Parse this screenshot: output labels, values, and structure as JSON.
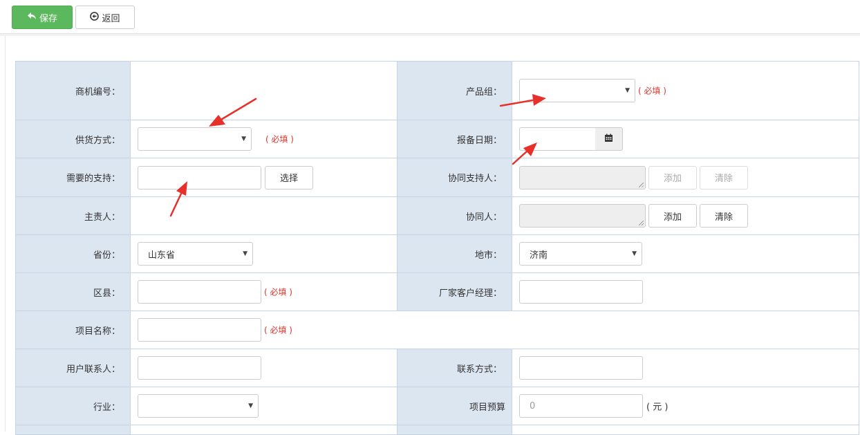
{
  "toolbar": {
    "save_label": "保存",
    "back_label": "返回"
  },
  "form": {
    "opportunity_no": {
      "label": "商机编号：",
      "value": ""
    },
    "product_group": {
      "label": "产品组：",
      "value": "",
      "required": "( 必填 )"
    },
    "supply_mode": {
      "label": "供货方式：",
      "value": "",
      "required": "( 必填 )"
    },
    "report_date": {
      "label": "报备日期：",
      "value": ""
    },
    "support_needed": {
      "label": "需要的支持：",
      "value": "",
      "button": "选择"
    },
    "co_supporter": {
      "label": "协同支持人：",
      "add": "添加",
      "clear": "清除"
    },
    "owner": {
      "label": "主责人：",
      "value": ""
    },
    "collaborator": {
      "label": "协同人：",
      "add": "添加",
      "clear": "清除"
    },
    "province": {
      "label": "省份：",
      "value": "山东省"
    },
    "city": {
      "label": "地市：",
      "value": "济南"
    },
    "district": {
      "label": "区县：",
      "value": "",
      "required": "( 必填 )"
    },
    "vendor_manager": {
      "label": "厂家客户经理：",
      "value": ""
    },
    "project_name": {
      "label": "项目名称：",
      "value": "",
      "required": "( 必填 )"
    },
    "user_contact": {
      "label": "用户联系人：",
      "value": ""
    },
    "contact_info": {
      "label": "联系方式：",
      "value": ""
    },
    "industry": {
      "label": "行业：",
      "value": ""
    },
    "budget": {
      "label": "项目预算",
      "placeholder": "0",
      "unit": "( 元 )"
    }
  },
  "icons": {
    "save": "reply-arrow-icon",
    "back": "circle-arrow-left-icon",
    "calendar": "calendar-icon"
  },
  "colors": {
    "save_button": "#5cb85c",
    "label_cell": "#dce6f1",
    "border": "#c5d3e4",
    "required": "#d9342b",
    "annotation_arrow": "#e8302a"
  }
}
